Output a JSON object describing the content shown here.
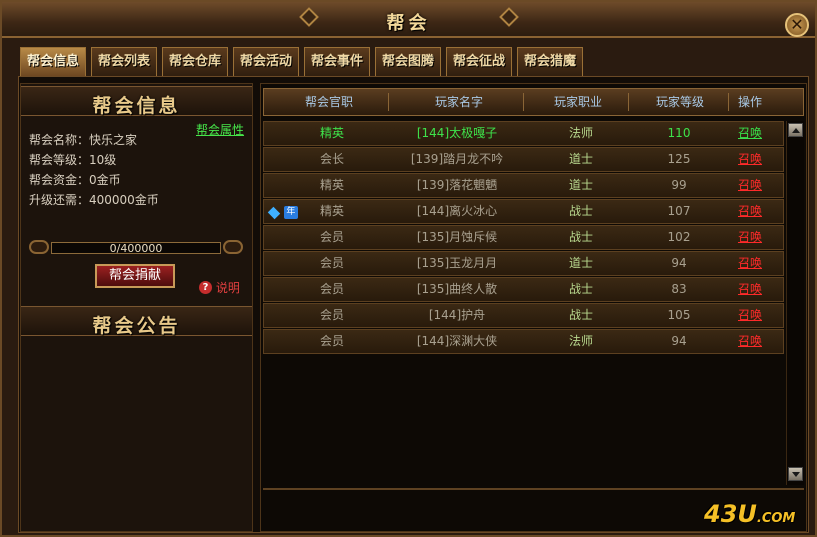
{
  "window": {
    "title": "帮会",
    "close_glyph": "✕"
  },
  "tabs": [
    {
      "label": "帮会信息",
      "active": true
    },
    {
      "label": "帮会列表",
      "active": false
    },
    {
      "label": "帮会仓库",
      "active": false
    },
    {
      "label": "帮会活动",
      "active": false
    },
    {
      "label": "帮会事件",
      "active": false
    },
    {
      "label": "帮会图腾",
      "active": false
    },
    {
      "label": "帮会征战",
      "active": false
    },
    {
      "label": "帮会猎魔",
      "active": false
    }
  ],
  "guild_info": {
    "heading": "帮会信息",
    "attr_link": "帮会属性",
    "name_line": "帮会名称：快乐之家",
    "level_line": "帮会等级：10级",
    "funds_line": "帮会资金：0金币",
    "upgrade_line": "升级还需：400000金币",
    "progress": {
      "text": "0/400000",
      "fraction": 0
    },
    "donate_label": "帮会捐献",
    "help_label": "说明",
    "help_glyph": "?"
  },
  "announcement": {
    "heading": "帮会公告"
  },
  "table": {
    "headers": [
      "帮会官职",
      "玩家名字",
      "玩家职业",
      "玩家等级",
      "操作"
    ],
    "rows": [
      {
        "title": "精英",
        "name": "[144]太极嘎子",
        "job": "法师",
        "level": "110",
        "op": "召唤",
        "highlight": true,
        "vip": false
      },
      {
        "title": "会长",
        "name": "[139]踏月龙不吟",
        "job": "道士",
        "level": "125",
        "op": "召唤",
        "highlight": false,
        "vip": false
      },
      {
        "title": "精英",
        "name": "[139]落花魍魉",
        "job": "道士",
        "level": "99",
        "op": "召唤",
        "highlight": false,
        "vip": false
      },
      {
        "title": "精英",
        "name": "[144]离火冰心",
        "job": "战士",
        "level": "107",
        "op": "召唤",
        "highlight": false,
        "vip": true
      },
      {
        "title": "会员",
        "name": "[135]月蚀斥候",
        "job": "战士",
        "level": "102",
        "op": "召唤",
        "highlight": false,
        "vip": false
      },
      {
        "title": "会员",
        "name": "[135]玉龙月月",
        "job": "道士",
        "level": "94",
        "op": "召唤",
        "highlight": false,
        "vip": false
      },
      {
        "title": "会员",
        "name": "[135]曲终人散",
        "job": "战士",
        "level": "83",
        "op": "召唤",
        "highlight": false,
        "vip": false
      },
      {
        "title": "会员",
        "name": "[144]护舟",
        "job": "战士",
        "level": "105",
        "op": "召唤",
        "highlight": false,
        "vip": false
      },
      {
        "title": "会员",
        "name": "[144]深渊大侠",
        "job": "法师",
        "level": "94",
        "op": "召唤",
        "highlight": false,
        "vip": false
      }
    ],
    "vip_badge": "年"
  },
  "watermark": {
    "text": "43U",
    "suffix": ".COM"
  },
  "colors": {
    "highlight_text": "#3ee24a",
    "normal_text": "#a8a08f",
    "job_text": "#b8d88e",
    "summon": "#ff2a2a"
  }
}
